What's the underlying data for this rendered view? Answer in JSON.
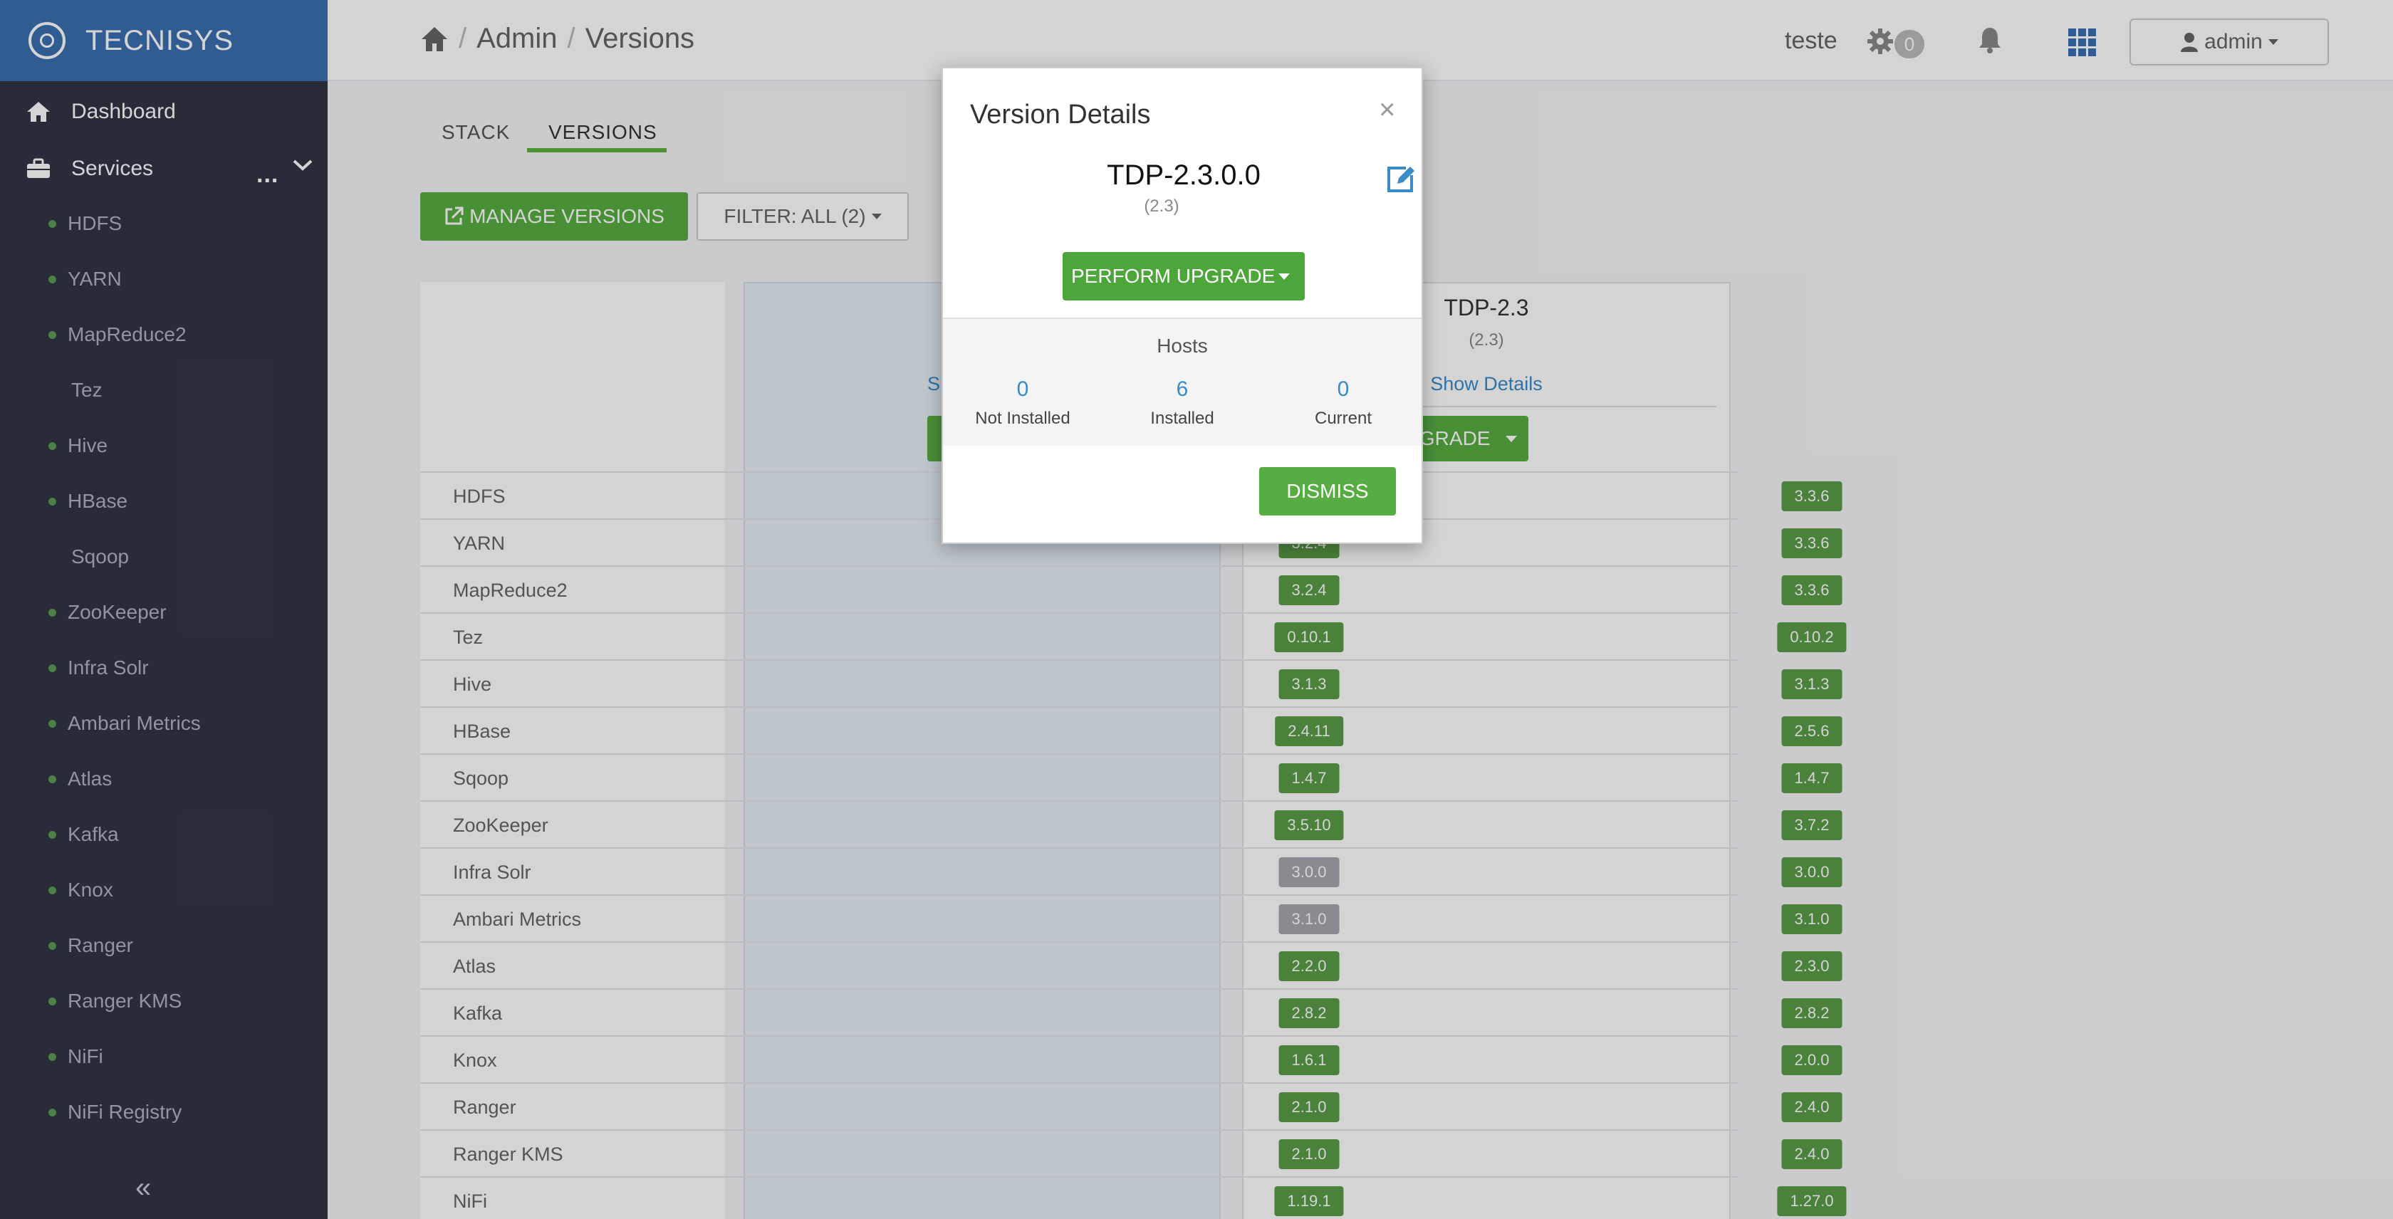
{
  "brand": {
    "name": "TECNISYS"
  },
  "sidebar": {
    "dashboard_label": "Dashboard",
    "services_label": "Services",
    "services_more": "...",
    "collapse_label": "«",
    "services": [
      {
        "label": "HDFS",
        "bullet": true
      },
      {
        "label": "YARN",
        "bullet": true
      },
      {
        "label": "MapReduce2",
        "bullet": true
      },
      {
        "label": "Tez",
        "bullet": false
      },
      {
        "label": "Hive",
        "bullet": true
      },
      {
        "label": "HBase",
        "bullet": true
      },
      {
        "label": "Sqoop",
        "bullet": false
      },
      {
        "label": "ZooKeeper",
        "bullet": true
      },
      {
        "label": "Infra Solr",
        "bullet": true
      },
      {
        "label": "Ambari Metrics",
        "bullet": true
      },
      {
        "label": "Atlas",
        "bullet": true
      },
      {
        "label": "Kafka",
        "bullet": true
      },
      {
        "label": "Knox",
        "bullet": true
      },
      {
        "label": "Ranger",
        "bullet": true
      },
      {
        "label": "Ranger KMS",
        "bullet": true
      },
      {
        "label": "NiFi",
        "bullet": true
      },
      {
        "label": "NiFi Registry",
        "bullet": true
      }
    ]
  },
  "header": {
    "breadcrumb": [
      "Admin",
      "Versions"
    ],
    "breadcrumb_sep": "/",
    "user_label": "teste",
    "ops_badge": "0",
    "admin_label": "admin"
  },
  "tabs": [
    "STACK",
    "VERSIONS"
  ],
  "toolbar": {
    "manage_label": "MANAGE VERSIONS",
    "filter_label": "FILTER: ALL (2)"
  },
  "columns": {
    "a": {
      "link_partial": "S"
    },
    "b": {
      "title": "TDP-2.3",
      "subtitle": "(2.3)",
      "show_details": "Show Details",
      "button_partial": "UPGRADE"
    }
  },
  "rows": [
    {
      "name": "HDFS",
      "a": "",
      "b": "3.3.6",
      "a_gray": false
    },
    {
      "name": "YARN",
      "a": "3.2.4",
      "b": "3.3.6",
      "a_gray": false
    },
    {
      "name": "MapReduce2",
      "a": "3.2.4",
      "b": "3.3.6",
      "a_gray": false
    },
    {
      "name": "Tez",
      "a": "0.10.1",
      "b": "0.10.2",
      "a_gray": false
    },
    {
      "name": "Hive",
      "a": "3.1.3",
      "b": "3.1.3",
      "a_gray": false
    },
    {
      "name": "HBase",
      "a": "2.4.11",
      "b": "2.5.6",
      "a_gray": false
    },
    {
      "name": "Sqoop",
      "a": "1.4.7",
      "b": "1.4.7",
      "a_gray": false
    },
    {
      "name": "ZooKeeper",
      "a": "3.5.10",
      "b": "3.7.2",
      "a_gray": false
    },
    {
      "name": "Infra Solr",
      "a": "3.0.0",
      "b": "3.0.0",
      "a_gray": true
    },
    {
      "name": "Ambari Metrics",
      "a": "3.1.0",
      "b": "3.1.0",
      "a_gray": true
    },
    {
      "name": "Atlas",
      "a": "2.2.0",
      "b": "2.3.0",
      "a_gray": false
    },
    {
      "name": "Kafka",
      "a": "2.8.2",
      "b": "2.8.2",
      "a_gray": false
    },
    {
      "name": "Knox",
      "a": "1.6.1",
      "b": "2.0.0",
      "a_gray": false
    },
    {
      "name": "Ranger",
      "a": "2.1.0",
      "b": "2.4.0",
      "a_gray": false
    },
    {
      "name": "Ranger KMS",
      "a": "2.1.0",
      "b": "2.4.0",
      "a_gray": false
    },
    {
      "name": "NiFi",
      "a": "1.19.1",
      "b": "1.27.0",
      "a_gray": false
    }
  ],
  "modal": {
    "title": "Version Details",
    "close": "×",
    "version_name": "TDP-2.3.0.0",
    "version_sub": "(2.3)",
    "upgrade_label": "PERFORM UPGRADE",
    "hosts_title": "Hosts",
    "hosts": [
      {
        "count": "0",
        "label": "Not Installed"
      },
      {
        "count": "6",
        "label": "Installed"
      },
      {
        "count": "0",
        "label": "Current"
      }
    ],
    "dismiss_label": "DISMISS"
  },
  "colors": {
    "accent_green": "#58ad42",
    "link_blue": "#3a8bc8",
    "sidebar_bg": "#323544",
    "brand_bg": "#3b6fb0"
  }
}
